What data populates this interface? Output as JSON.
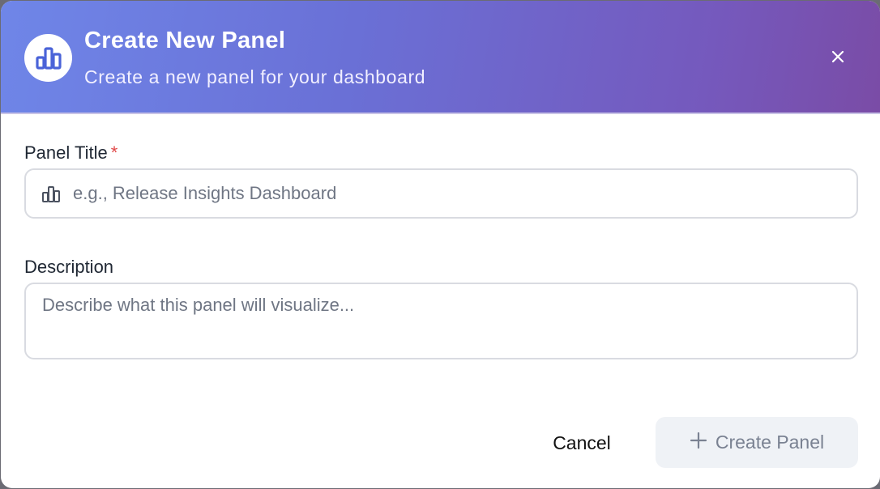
{
  "dialog": {
    "title": "Create New Panel",
    "subtitle": "Create a new panel for your dashboard",
    "header_icon": "bar-chart-icon",
    "close_icon": "close-icon",
    "gradient_colors": [
      "#6f86e8",
      "#7a4ca6"
    ]
  },
  "form": {
    "panel_title": {
      "label": "Panel Title",
      "required_marker": "*",
      "placeholder": "e.g., Release Insights Dashboard",
      "value": "",
      "icon": "bar-chart-icon"
    },
    "description": {
      "label": "Description",
      "placeholder": "Describe what this panel will visualize...",
      "value": ""
    }
  },
  "actions": {
    "cancel_label": "Cancel",
    "create_label": "Create Panel",
    "create_icon": "plus-icon",
    "create_disabled": true
  },
  "colors": {
    "accent": "#4a63d8",
    "required": "#e04848",
    "disabled_button_bg": "#eff2f6",
    "disabled_button_text": "#7a8292"
  }
}
